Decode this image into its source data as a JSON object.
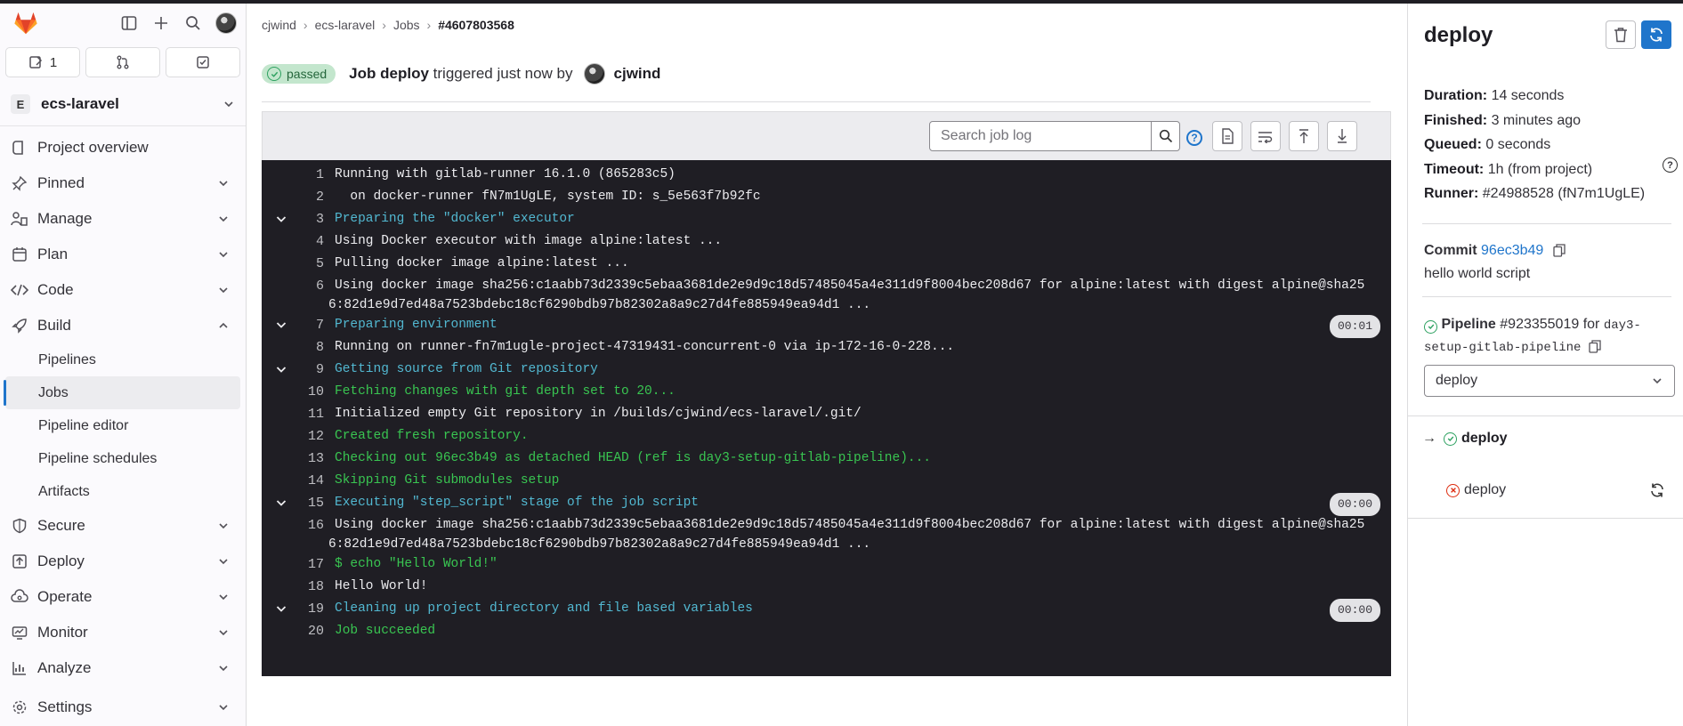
{
  "sidebar": {
    "counters": {
      "issues": "1"
    },
    "project": {
      "initial": "E",
      "name": "ecs-laravel"
    },
    "nav": [
      {
        "label": "Project overview"
      },
      {
        "label": "Pinned"
      },
      {
        "label": "Manage"
      },
      {
        "label": "Plan"
      },
      {
        "label": "Code"
      },
      {
        "label": "Build"
      },
      {
        "label": "Secure"
      },
      {
        "label": "Deploy"
      },
      {
        "label": "Operate"
      },
      {
        "label": "Monitor"
      },
      {
        "label": "Analyze"
      },
      {
        "label": "Settings"
      }
    ],
    "build_sub": [
      {
        "label": "Pipelines"
      },
      {
        "label": "Jobs"
      },
      {
        "label": "Pipeline editor"
      },
      {
        "label": "Pipeline schedules"
      },
      {
        "label": "Artifacts"
      }
    ]
  },
  "breadcrumb": [
    "cjwind",
    "ecs-laravel",
    "Jobs",
    "#4607803568"
  ],
  "job": {
    "status": "passed",
    "prefix": "Job",
    "name": "deploy",
    "triggered": "triggered just now by",
    "user": "cjwind"
  },
  "toolbar": {
    "search_placeholder": "Search job log"
  },
  "log": [
    {
      "n": "1",
      "text": "Running with gitlab-runner 16.1.0 (865283c5)",
      "color": "white"
    },
    {
      "n": "2",
      "text": "  on docker-runner fN7m1UgLE, system ID: s_5e563f7b92fc",
      "color": "white"
    },
    {
      "n": "3",
      "text": "Preparing the \"docker\" executor",
      "color": "cyan",
      "section": true
    },
    {
      "n": "4",
      "text": "Using Docker executor with image alpine:latest ...",
      "color": "white"
    },
    {
      "n": "5",
      "text": "Pulling docker image alpine:latest ...",
      "color": "white"
    },
    {
      "n": "6",
      "text": "Using docker image sha256:c1aabb73d2339c5ebaa3681de2e9d9c18d57485045a4e311d9f8004bec208d67 for alpine:latest with digest alpine@sha256:82d1e9d7ed48a7523bdebc18cf6290bdb97b82302a8a9c27d4fe885949ea94d1 ...",
      "color": "white",
      "wrap": true
    },
    {
      "n": "7",
      "text": "Preparing environment",
      "color": "cyan",
      "section": true,
      "duration": "00:01"
    },
    {
      "n": "8",
      "text": "Running on runner-fn7m1ugle-project-47319431-concurrent-0 via ip-172-16-0-228...",
      "color": "white"
    },
    {
      "n": "9",
      "text": "Getting source from Git repository",
      "color": "cyan",
      "section": true
    },
    {
      "n": "10",
      "text": "Fetching changes with git depth set to 20...",
      "color": "green"
    },
    {
      "n": "11",
      "text": "Initialized empty Git repository in /builds/cjwind/ecs-laravel/.git/",
      "color": "white"
    },
    {
      "n": "12",
      "text": "Created fresh repository.",
      "color": "green"
    },
    {
      "n": "13",
      "text": "Checking out 96ec3b49 as detached HEAD (ref is day3-setup-gitlab-pipeline)...",
      "color": "green"
    },
    {
      "n": "14",
      "text": "Skipping Git submodules setup",
      "color": "green"
    },
    {
      "n": "15",
      "text": "Executing \"step_script\" stage of the job script",
      "color": "cyan",
      "section": true,
      "duration": "00:00"
    },
    {
      "n": "16",
      "text": "Using docker image sha256:c1aabb73d2339c5ebaa3681de2e9d9c18d57485045a4e311d9f8004bec208d67 for alpine:latest with digest alpine@sha256:82d1e9d7ed48a7523bdebc18cf6290bdb97b82302a8a9c27d4fe885949ea94d1 ...",
      "color": "white",
      "wrap": true
    },
    {
      "n": "17",
      "text": "$ echo \"Hello World!\"",
      "color": "green"
    },
    {
      "n": "18",
      "text": "Hello World!",
      "color": "white"
    },
    {
      "n": "19",
      "text": "Cleaning up project directory and file based variables",
      "color": "cyan",
      "section": true,
      "duration": "00:00"
    },
    {
      "n": "20",
      "text": "Job succeeded",
      "color": "green"
    }
  ],
  "panel": {
    "title": "deploy",
    "duration_label": "Duration:",
    "duration": "14 seconds",
    "finished_label": "Finished:",
    "finished": "3 minutes ago",
    "queued_label": "Queued:",
    "queued": "0 seconds",
    "timeout_label": "Timeout:",
    "timeout": "1h (from project)",
    "runner_label": "Runner:",
    "runner": "#24988528 (fN7m1UgLE)",
    "commit_label": "Commit",
    "commit_sha": "96ec3b49",
    "commit_msg": "hello world script",
    "pipeline_label": "Pipeline",
    "pipeline_id": "#923355019",
    "pipeline_for": "for",
    "pipeline_ref": "day3-setup-gitlab-pipeline",
    "stage_select": "deploy",
    "jobs": [
      {
        "name": "deploy",
        "status": "success",
        "current": true
      },
      {
        "name": "deploy",
        "status": "failed",
        "current": false
      }
    ]
  },
  "colors": {
    "accent": "#1f75cb",
    "success": "#2da160",
    "failed": "#dd2b0e",
    "log_bg": "#1f1e24"
  }
}
